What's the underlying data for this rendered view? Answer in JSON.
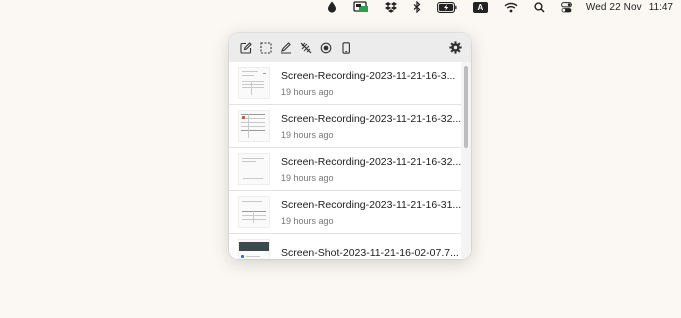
{
  "menubar": {
    "icons": [
      "drop-icon",
      "screenshot-app-icon",
      "dropbox-icon",
      "bluetooth-icon",
      "battery-icon",
      "wifi-icon",
      "search-icon",
      "control-center-icon"
    ],
    "input_source": "A",
    "date": "Wed 22 Nov",
    "time": "11:47"
  },
  "toolbar": {
    "tools": [
      "edit-icon",
      "capture-area-icon",
      "annotate-icon",
      "hide-desktop-icon",
      "record-icon",
      "device-frame-icon"
    ],
    "settings": "gear-icon"
  },
  "history": [
    {
      "name": "Screen-Recording-2023-11-21-16-3...",
      "time": "19 hours ago"
    },
    {
      "name": "Screen-Recording-2023-11-21-16-32...",
      "time": "19 hours ago"
    },
    {
      "name": "Screen-Recording-2023-11-21-16-32...",
      "time": "19 hours ago"
    },
    {
      "name": "Screen-Recording-2023-11-21-16-31...",
      "time": "19 hours ago"
    },
    {
      "name": "Screen-Shot-2023-11-21-16-02-07.7...",
      "time": ""
    }
  ]
}
